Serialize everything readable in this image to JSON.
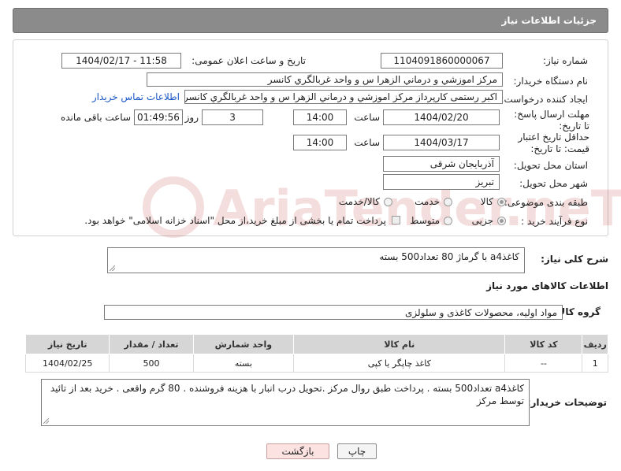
{
  "header": {
    "title": "جزئیات اطلاعات نیاز"
  },
  "fields": {
    "need_number_label": "شماره نیاز:",
    "need_number": "1104091860000067",
    "announce_label": "تاریخ و ساعت اعلان عمومی:",
    "announce_value": "1404/02/17 - 11:58",
    "buyer_org_label": "نام دستگاه خریدار:",
    "buyer_org": "مرکز اموزشي و درماني الزهرا س  و واحد غربالگري کانسر",
    "requester_label": "ایجاد کننده درخواست:",
    "requester": "اکبر رستمی کارپرداز مرکز اموزشي و درماني الزهرا س  و واحد غربالگري کانسر",
    "contact_link": "اطلاعات تماس خریدار",
    "deadline_label": "مهلت ارسال پاسخ: تا تاریخ:",
    "deadline_date": "1404/02/20",
    "time_label": "ساعت",
    "deadline_time": "14:00",
    "days_value": "3",
    "days_label": "روز و",
    "remaining_time": "01:49:56",
    "remaining_label": "ساعت باقی مانده",
    "validity_label": "حداقل تاریخ اعتبار قیمت: تا تاریخ:",
    "validity_date": "1404/03/17",
    "validity_time": "14:00",
    "province_label": "استان محل تحویل:",
    "province": "آذربایجان شرقی",
    "city_label": "شهر محل تحویل:",
    "city": "تبریز",
    "category_label": "طبقه بندی موضوعی:",
    "category_options": [
      "کالا",
      "خدمت",
      "کالا/خدمت"
    ],
    "process_label": "نوع فرآیند خرید :",
    "process_options": [
      "جزیی",
      "متوسط"
    ],
    "payment_note": "پرداخت تمام یا بخشی از مبلغ خرید،از محل \"اسناد خزانه اسلامی\" خواهد بود."
  },
  "description": {
    "label": "شرح کلی نیاز:",
    "value": "کاغذa4 با گرماژ 80 تعداد500 بسته"
  },
  "goods": {
    "section_title": "اطلاعات کالاهای مورد نیاز",
    "group_label": "گروه کالا:",
    "group_value": "مواد اولیه، محصولات کاغذی و سلولزی",
    "columns": [
      "ردیف",
      "کد کالا",
      "نام کالا",
      "واحد شمارش",
      "تعداد / مقدار",
      "تاریخ نیاز"
    ],
    "rows": [
      {
        "index": "1",
        "code": "--",
        "name": "کاغذ چاپگر یا کپی",
        "unit": "بسته",
        "qty": "500",
        "date": "1404/02/25"
      }
    ]
  },
  "buyer_notes": {
    "label": "توضیحات خریدار:",
    "value": "کاغذa4 تعداد500 بسته . پرداخت طبق روال مرکز .تحویل درب انبار با هزینه فروشنده . 80 گرم واقعی . خرید بعد از تائید توسط مرکز"
  },
  "buttons": {
    "print": "چاپ",
    "back": "بازگشت"
  },
  "watermark": {
    "text": "AriaTender.neT",
    "color": "#b30000"
  }
}
